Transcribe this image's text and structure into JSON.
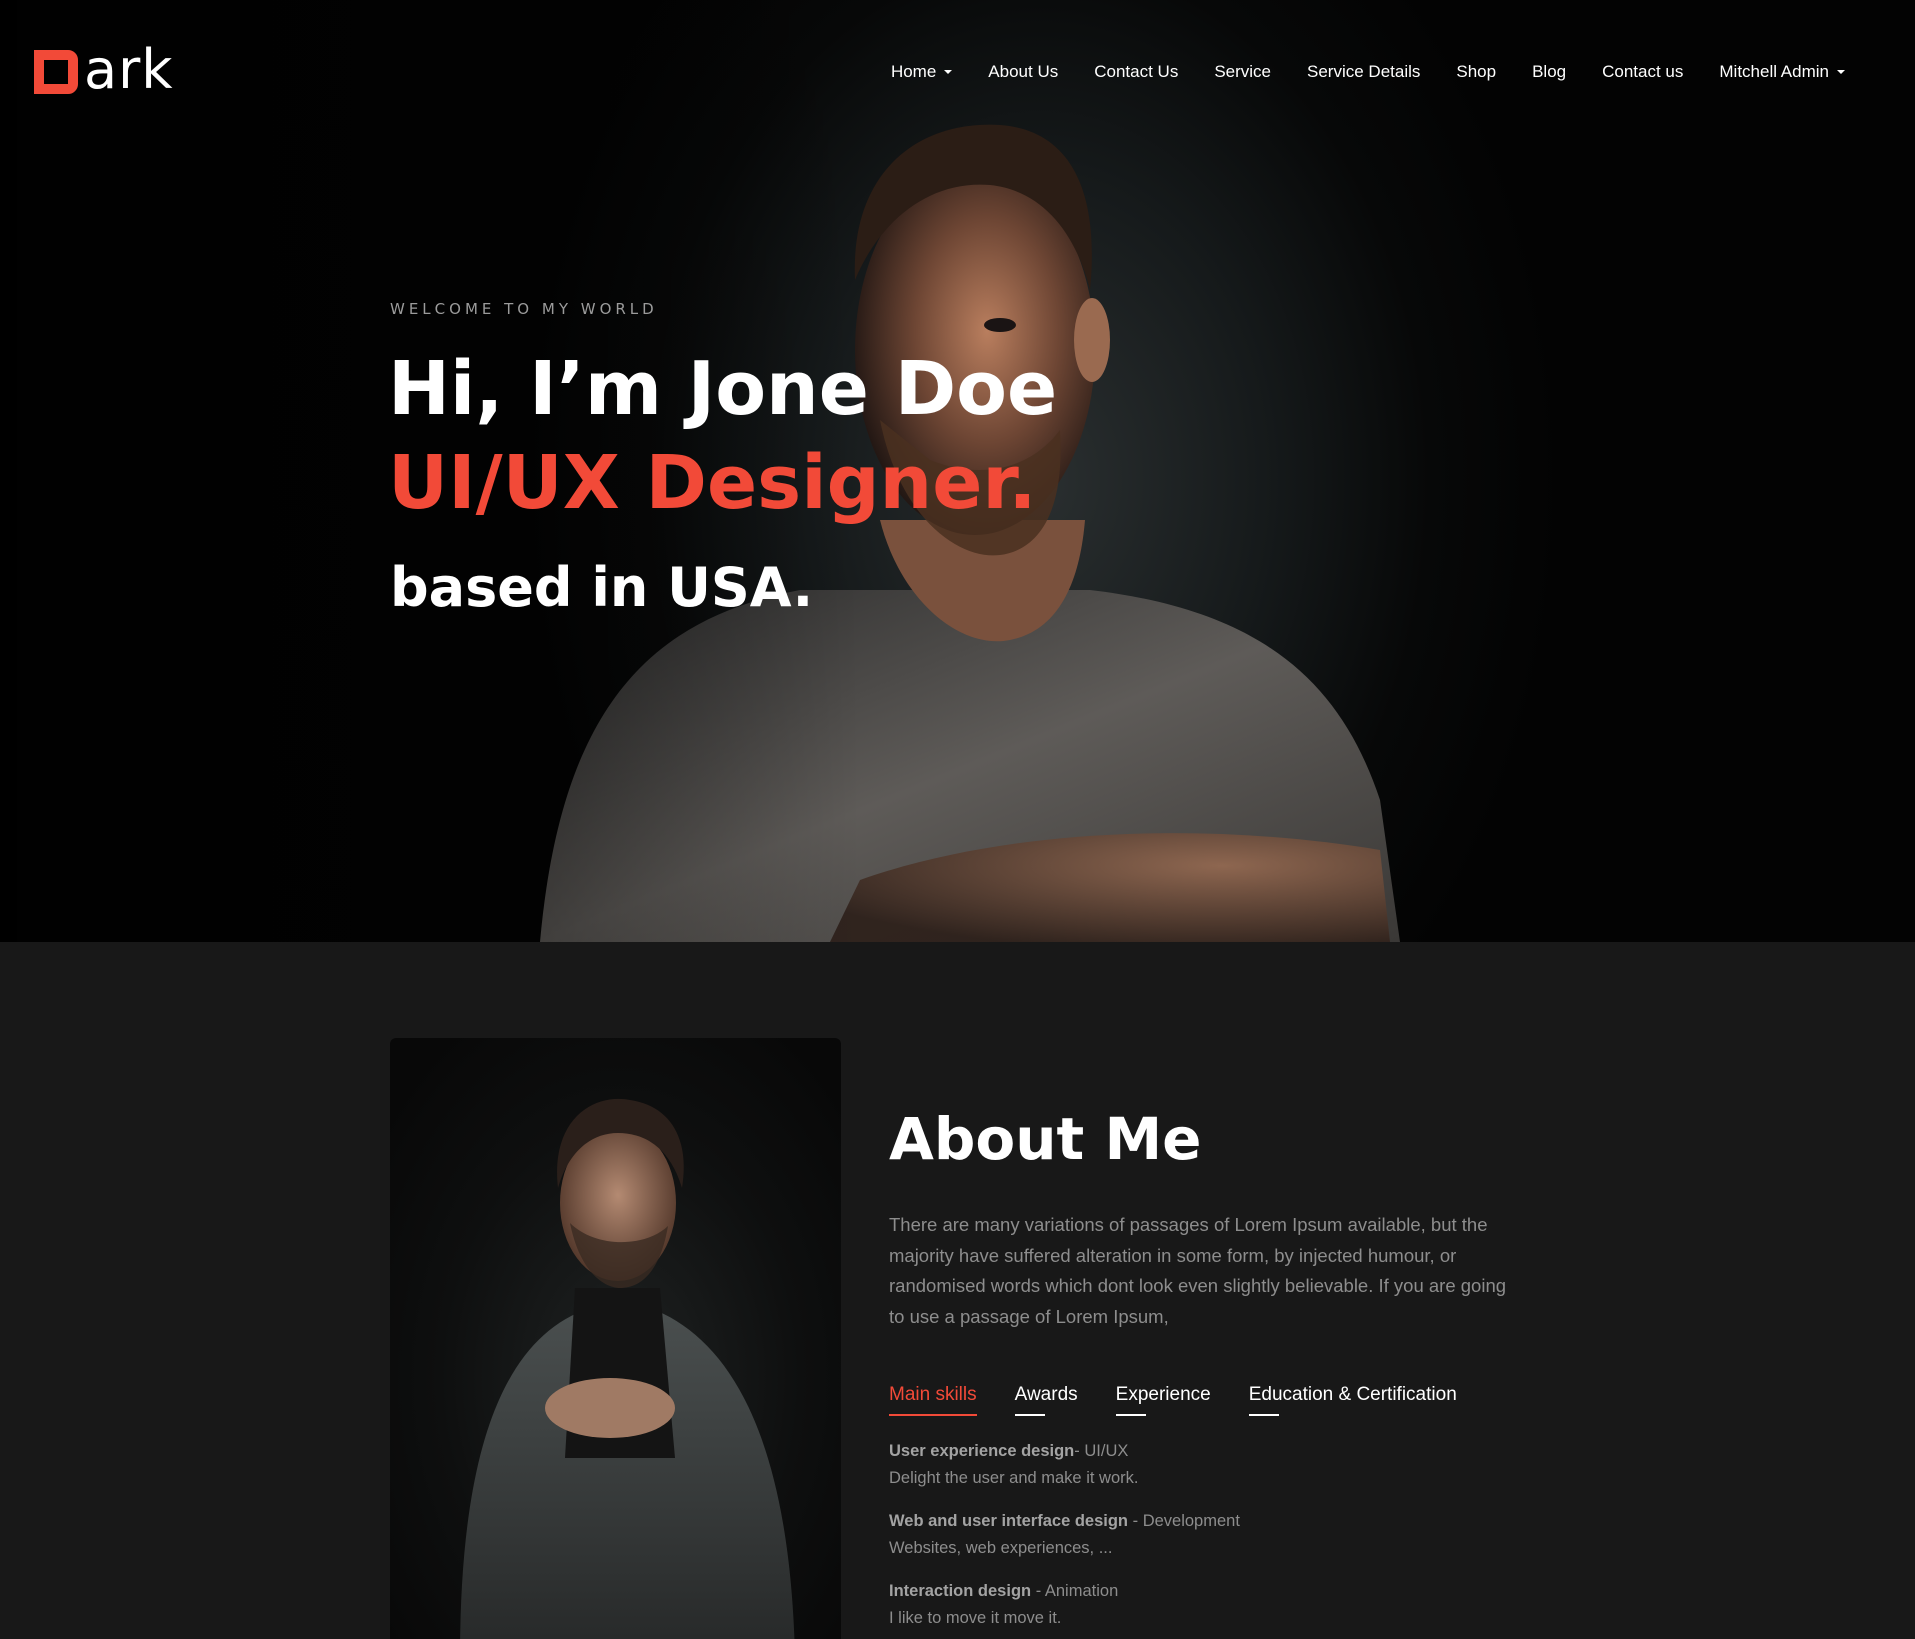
{
  "brand": {
    "logo_text": "ark",
    "logo_letter": "D",
    "accent": "#f24a38"
  },
  "nav": {
    "items": [
      {
        "label": "Home",
        "has_dropdown": true
      },
      {
        "label": "About Us",
        "has_dropdown": false
      },
      {
        "label": "Contact Us",
        "has_dropdown": false
      },
      {
        "label": "Service",
        "has_dropdown": false
      },
      {
        "label": "Service Details",
        "has_dropdown": false
      },
      {
        "label": "Shop",
        "has_dropdown": false
      },
      {
        "label": "Blog",
        "has_dropdown": false
      },
      {
        "label": "Contact us",
        "has_dropdown": false
      },
      {
        "label": "Mitchell Admin",
        "has_dropdown": true
      }
    ]
  },
  "hero": {
    "kicker": "WELCOME TO MY WORLD",
    "name_line": "Hi, I’m Jone Doe",
    "role_line": "UI/UX Designer.",
    "location_line": "based in USA."
  },
  "about": {
    "title": "About Me",
    "paragraph": "There are many variations of passages of Lorem Ipsum available, but the majority have suffered alteration in some form, by injected humour, or randomised words which dont look even slightly believable. If you are going to use a passage of Lorem Ipsum,",
    "tabs": [
      {
        "label": "Main skills",
        "active": true
      },
      {
        "label": "Awards",
        "active": false
      },
      {
        "label": "Experience",
        "active": false
      },
      {
        "label": "Education & Certification",
        "active": false
      }
    ],
    "skills": [
      {
        "title": "User experience design",
        "sep": "- ",
        "tag": "UI/UX",
        "desc": "Delight the user and make it work."
      },
      {
        "title": "Web and user interface design",
        "sep": " - ",
        "tag": "Development",
        "desc": "Websites, web experiences, ..."
      },
      {
        "title": "Interaction design",
        "sep": " - ",
        "tag": "Animation",
        "desc": "I like to move it move it."
      }
    ]
  }
}
